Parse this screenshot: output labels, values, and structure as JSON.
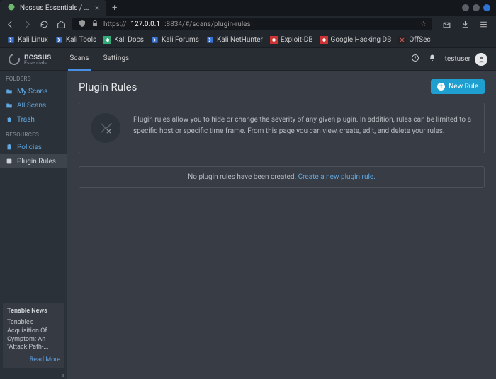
{
  "browser": {
    "tab_title": "Nessus Essentials / Resou",
    "url_proto": "https://",
    "url_host": "127.0.0.1",
    "url_rest": ":8834/#/scans/plugin-rules"
  },
  "bookmarks": [
    {
      "label": "Kali Linux",
      "fav": "k"
    },
    {
      "label": "Kali Tools",
      "fav": "k"
    },
    {
      "label": "Kali Docs",
      "fav": "g"
    },
    {
      "label": "Kali Forums",
      "fav": "k"
    },
    {
      "label": "Kali NetHunter",
      "fav": "k"
    },
    {
      "label": "Exploit-DB",
      "fav": "r"
    },
    {
      "label": "Google Hacking DB",
      "fav": "r"
    },
    {
      "label": "OffSec",
      "fav": "o"
    }
  ],
  "app": {
    "logo_name": "nessus",
    "logo_sub": "Essentials",
    "tabs": [
      {
        "label": "Scans",
        "active": true
      },
      {
        "label": "Settings",
        "active": false
      }
    ],
    "username": "testuser"
  },
  "sidebar": {
    "section_folders": "FOLDERS",
    "section_resources": "RESOURCES",
    "folders": [
      {
        "label": "My Scans",
        "icon": "folder"
      },
      {
        "label": "All Scans",
        "icon": "folder"
      },
      {
        "label": "Trash",
        "icon": "trash"
      }
    ],
    "resources": [
      {
        "label": "Policies",
        "icon": "clipboard",
        "selected": false
      },
      {
        "label": "Plugin Rules",
        "icon": "plug",
        "selected": true
      }
    ],
    "news": {
      "heading": "Tenable News",
      "body": "Tenable's Acquisition Of Cymptom: An \"Attack Path-...",
      "readmore": "Read More"
    }
  },
  "page": {
    "title": "Plugin Rules",
    "new_rule_label": "New Rule",
    "info": "Plugin rules allow you to hide or change the severity of any given plugin. In addition, rules can be limited to a specific host or specific time frame. From this page you can view, create, edit, and delete your rules.",
    "empty_msg": "No plugin rules have been created. ",
    "empty_link": "Create a new plugin rule."
  }
}
